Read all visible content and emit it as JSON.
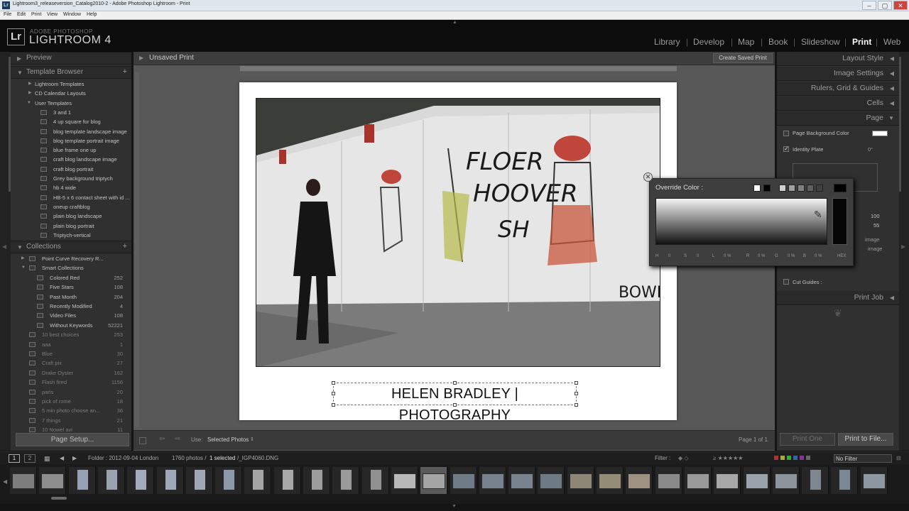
{
  "window": {
    "title": "Lightroom3_releaseversion_Catalog2010-2 - Adobe Photoshop Lightroom - Print",
    "menu": [
      "File",
      "Edit",
      "Print",
      "View",
      "Window",
      "Help"
    ]
  },
  "brand": {
    "logo": "Lr",
    "line1": "ADOBE PHOTOSHOP",
    "line2": "LIGHTROOM 4"
  },
  "modules": [
    "Library",
    "Develop",
    "Map",
    "Book",
    "Slideshow",
    "Print",
    "Web"
  ],
  "active_module": "Print",
  "left_panel": {
    "preview_label": "Preview",
    "template_browser_label": "Template Browser",
    "template_folders": [
      "Lightroom Templates",
      "CD Calendar Layouts",
      "User Templates"
    ],
    "user_templates": [
      "3 and 1",
      "4 up square for blog",
      "blog template landscape image",
      "blog template portrait image",
      "blue frame one up",
      "craft blog landscape image",
      "craft blog portrait",
      "Grey background triptych",
      "hb 4 wide",
      "HB-5 x 6 contact sheet with id ...",
      "oneup craftblog",
      "plain blog landscape",
      "plain blog portrait",
      "Triptych-vertical"
    ],
    "collections_label": "Collections",
    "collections": [
      {
        "name": "Point Curve Recovery R...",
        "count": ""
      },
      {
        "name": "Smart Collections",
        "count": ""
      },
      {
        "name": "Colored Red",
        "count": "252"
      },
      {
        "name": "Five Stars",
        "count": "108"
      },
      {
        "name": "Past Month",
        "count": "204"
      },
      {
        "name": "Recently Modified",
        "count": "4"
      },
      {
        "name": "Video Files",
        "count": "108"
      },
      {
        "name": "Without Keywords",
        "count": "52221"
      },
      {
        "name": "10 best choices",
        "count": "253"
      },
      {
        "name": "aaa",
        "count": "1"
      },
      {
        "name": "Blue",
        "count": "30"
      },
      {
        "name": "Craft pix",
        "count": "27"
      },
      {
        "name": "Drake Oyster",
        "count": "162"
      },
      {
        "name": "Flash fired",
        "count": "1156"
      },
      {
        "name": "paris",
        "count": "20"
      },
      {
        "name": "pick of rome",
        "count": "18"
      },
      {
        "name": "5 min photo choose an...",
        "count": "36"
      },
      {
        "name": "7 things",
        "count": "21"
      },
      {
        "name": "10 Nowel avi",
        "count": "11"
      }
    ],
    "page_setup_label": "Page Setup..."
  },
  "center": {
    "doc_title": "Unsaved Print",
    "create_saved_print": "Create Saved Print",
    "caption": "HELEN BRADLEY | PHOTOGRAPHY",
    "use_label": "Use:",
    "use_value": "Selected Photos",
    "page_of": "Page 1 of 1"
  },
  "right_panel": {
    "layout_style": "Layout Style",
    "image_settings": "Image Settings",
    "rulers_grid_guides": "Rulers, Grid & Guides",
    "cells": "Cells",
    "page": "Page",
    "page_background_color": "Page Background Color",
    "identity_plate": "Identity Plate",
    "identity_plate_angle": "0°",
    "value_100": "100",
    "value_55": "55",
    "image_1": "image",
    "image_2": "image",
    "cut_guides": "Cut Guides :",
    "print_job": "Print Job",
    "print_one": "Print One",
    "print_to_file": "Print to File..."
  },
  "color_picker": {
    "title": "Override Color :",
    "params": [
      "H",
      "0",
      "S",
      "0",
      "L",
      "0 %",
      "R",
      "0 %",
      "G",
      "0 %",
      "B",
      "0 %",
      "HEX"
    ]
  },
  "filmstrip_bar": {
    "page1": "1",
    "page2": "2",
    "folder": "Folder : 2012-09-04 London",
    "photos": "1760 photos /",
    "selected": "1 selected",
    "file": "/_IGP4060.DNG",
    "filter_label": "Filter :",
    "no_filter": "No Filter"
  },
  "colors": {
    "panel_bg": "#303030",
    "center_bg": "#585858",
    "active_module": "#ffffff"
  }
}
